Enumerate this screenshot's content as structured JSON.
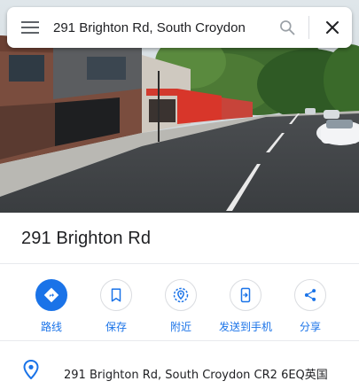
{
  "search": {
    "query": "291 Brighton Rd, South Croydon"
  },
  "place": {
    "title": "291 Brighton Rd",
    "address": "291 Brighton Rd, South Croydon CR2 6EQ英国"
  },
  "actions": [
    {
      "label": "路线",
      "icon": "directions-icon"
    },
    {
      "label": "保存",
      "icon": "bookmark-icon"
    },
    {
      "label": "附近",
      "icon": "nearby-icon"
    },
    {
      "label": "发送到手机",
      "icon": "phone-icon"
    },
    {
      "label": "分享",
      "icon": "share-icon"
    }
  ],
  "colors": {
    "accent": "#1a73e8",
    "text": "#202124",
    "icon_gray": "#5f6368"
  }
}
